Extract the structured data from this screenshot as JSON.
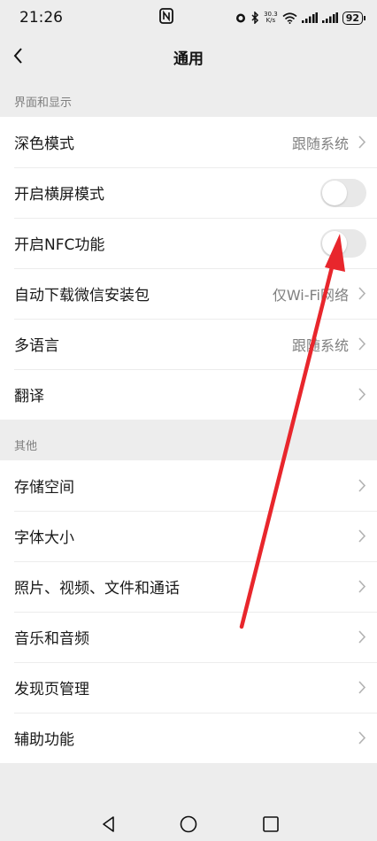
{
  "status_bar": {
    "time": "21:26",
    "net_speed_value": "30.3",
    "net_speed_unit": "K/s",
    "battery": "92"
  },
  "nav": {
    "title": "通用",
    "icons": {
      "back": "chevron-left-icon"
    }
  },
  "sections": [
    {
      "header": "界面和显示",
      "rows": [
        {
          "label": "深色模式",
          "value": "跟随系统"
        },
        {
          "label": "开启横屏模式",
          "toggle": false
        },
        {
          "label": "开启NFC功能",
          "toggle": false
        },
        {
          "label": "自动下载微信安装包",
          "value": "仅Wi-Fi网络"
        },
        {
          "label": "多语言",
          "value": "跟随系统"
        },
        {
          "label": "翻译"
        }
      ]
    },
    {
      "header": "其他",
      "rows": [
        {
          "label": "存储空间"
        },
        {
          "label": "字体大小"
        },
        {
          "label": "照片、视频、文件和通话"
        },
        {
          "label": "音乐和音频"
        },
        {
          "label": "发现页管理"
        },
        {
          "label": "辅助功能"
        }
      ]
    }
  ],
  "annotation": {
    "arrow_color": "#e8262c"
  },
  "colors": {
    "background": "#ededed",
    "card": "#ffffff",
    "toggle_off": "#e8e8e8",
    "secondary_text": "#808080"
  }
}
